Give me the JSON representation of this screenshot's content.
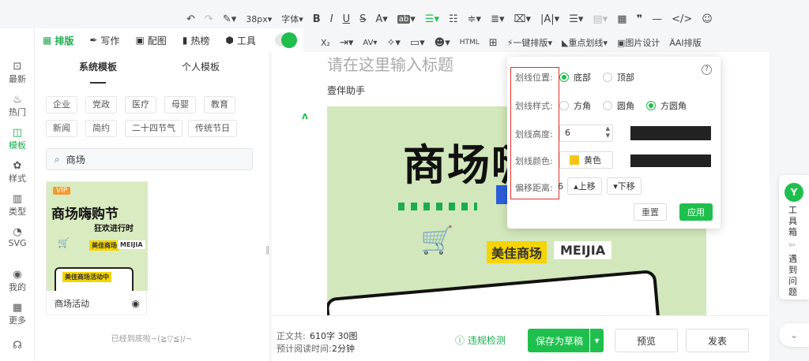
{
  "toolbar1": {
    "font_size": "38px",
    "font_family": "字体",
    "bold": "B",
    "italic": "I",
    "underline": "U",
    "strike": "S",
    "color": "A",
    "bg": "ab"
  },
  "toolbar2": {
    "one_click_layout": "一键排版",
    "highlight_underline": "重点划线",
    "image_design": "图片设计",
    "ai_layout": "AI排版"
  },
  "main_tabs": [
    {
      "label": "排版",
      "active": true
    },
    {
      "label": "写作"
    },
    {
      "label": "配图"
    },
    {
      "label": "热榜"
    },
    {
      "label": "工具"
    }
  ],
  "rail": [
    {
      "label": "最新"
    },
    {
      "label": "热门"
    },
    {
      "label": "模板"
    },
    {
      "label": "样式"
    },
    {
      "label": "类型"
    },
    {
      "label": "SVG"
    },
    {
      "label": "我的"
    },
    {
      "label": "更多"
    }
  ],
  "subtabs": {
    "system": "系统模板",
    "personal": "个人模板"
  },
  "tags": [
    "企业",
    "党政",
    "医疗",
    "母婴",
    "教育",
    "新闻",
    "简约",
    "二十四节气",
    "传统节日"
  ],
  "search": {
    "value": "商场"
  },
  "card": {
    "name": "商场活动",
    "thumb_badge": "VIP",
    "thumb_title": "商场嗨购节",
    "thumb_sub": "狂欢进行时",
    "thumb_brand_cn": "美佳商场",
    "thumb_brand_en": "MEIJIA",
    "thumb_banner": "美佳商场活动中"
  },
  "end_text": "已经到底啦~(≧▽≦)/~",
  "editor": {
    "title_placeholder": "请在这里输入标题",
    "author": "壹伴助手",
    "big_text": "商场嗨",
    "brand_cn": "美佳商场",
    "brand_en": "MEIJIA"
  },
  "footer": {
    "word_count_label": "正文共:",
    "word_count": "610字 30图",
    "read_label": "预计阅读时间:",
    "read_time": "2分钟",
    "check": "违规检测",
    "save_draft": "保存为草稿",
    "preview": "预览",
    "publish": "发表"
  },
  "popup": {
    "position_label": "划线位置:",
    "position_opts": [
      "底部",
      "顶部"
    ],
    "style_label": "划线样式:",
    "style_opts": [
      "方角",
      "圆角",
      "方圆角"
    ],
    "height_label": "划线高度:",
    "height_value": "6",
    "color_label": "划线颜色:",
    "color_value": "黄色",
    "color_hex": "#f5c518",
    "offset_label": "偏移距离:",
    "offset_value": "6",
    "up": "上移",
    "down": "下移",
    "reset": "重置",
    "apply": "应用",
    "help": "?"
  },
  "toolbox": {
    "label": "工具箱",
    "feedback": "遇到问题"
  },
  "colors": {
    "brand_green": "#1fbf4d",
    "highlight_red": "#e0302b"
  }
}
